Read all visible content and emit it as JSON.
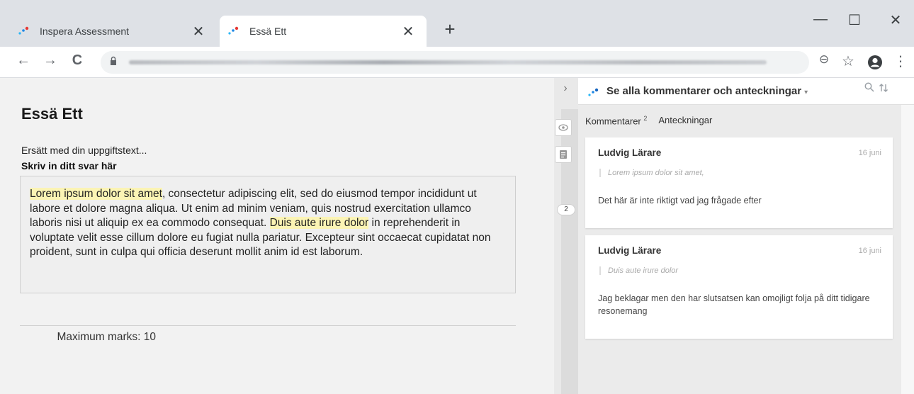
{
  "browser": {
    "tabs": [
      {
        "title": "Inspera Assessment",
        "active": false
      },
      {
        "title": "Essä Ett",
        "active": true
      }
    ],
    "close_glyph": "✕",
    "new_tab_glyph": "+",
    "window_controls": {
      "minimize": "—",
      "maximize": "☐",
      "close": "✕"
    },
    "toolbar": {
      "back": "←",
      "forward": "→",
      "reload": "C",
      "lock": "🔒",
      "zoom": "⊖",
      "star": "☆",
      "menu": "⋮"
    },
    "accent_color": "#1a73e8"
  },
  "assignment": {
    "title": "Essä Ett",
    "task_text": "Ersätt med din uppgiftstext...",
    "answer_label": "Skriv in ditt svar här",
    "answer_segments": [
      {
        "text": "Lorem ipsum dolor sit amet",
        "highlight": true
      },
      {
        "text": ", consectetur adipiscing elit, sed do eiusmod tempor incididunt ut labore et dolore magna aliqua. Ut enim ad minim veniam, quis nostrud exercitation ullamco laboris nisi ut aliquip ex ea commodo consequat. ",
        "highlight": false
      },
      {
        "text": "Duis aute irure dolor",
        "highlight": true
      },
      {
        "text": " in reprehenderit in voluptate velit esse cillum dolore eu fugiat nulla pariatur. Excepteur sint occaecat cupidatat non proident, sunt in culpa qui officia deserunt mollit anim id est laborum.",
        "highlight": false
      }
    ],
    "highlight_color": "#fbf4b4",
    "max_marks": "Maximum marks: 10"
  },
  "gutter": {
    "toggle": "›",
    "comment_count": "2"
  },
  "panel": {
    "title": "Se alla kommentarer och anteckningar",
    "caret": "▾",
    "tabs": {
      "comments": "Kommentarer",
      "comments_count": "2",
      "notes": "Anteckningar"
    },
    "comments": [
      {
        "author": "Ludvig Lärare",
        "date": "16 juni",
        "quote": "Lorem ipsum dolor sit amet,",
        "text": "Det här är inte riktigt vad jag frågade efter"
      },
      {
        "author": "Ludvig Lärare",
        "date": "16 juni",
        "quote": "Duis aute irure dolor",
        "text": "Jag beklagar men den har slutsatsen kan omojligt folja på ditt tidigare resonemang"
      }
    ]
  }
}
